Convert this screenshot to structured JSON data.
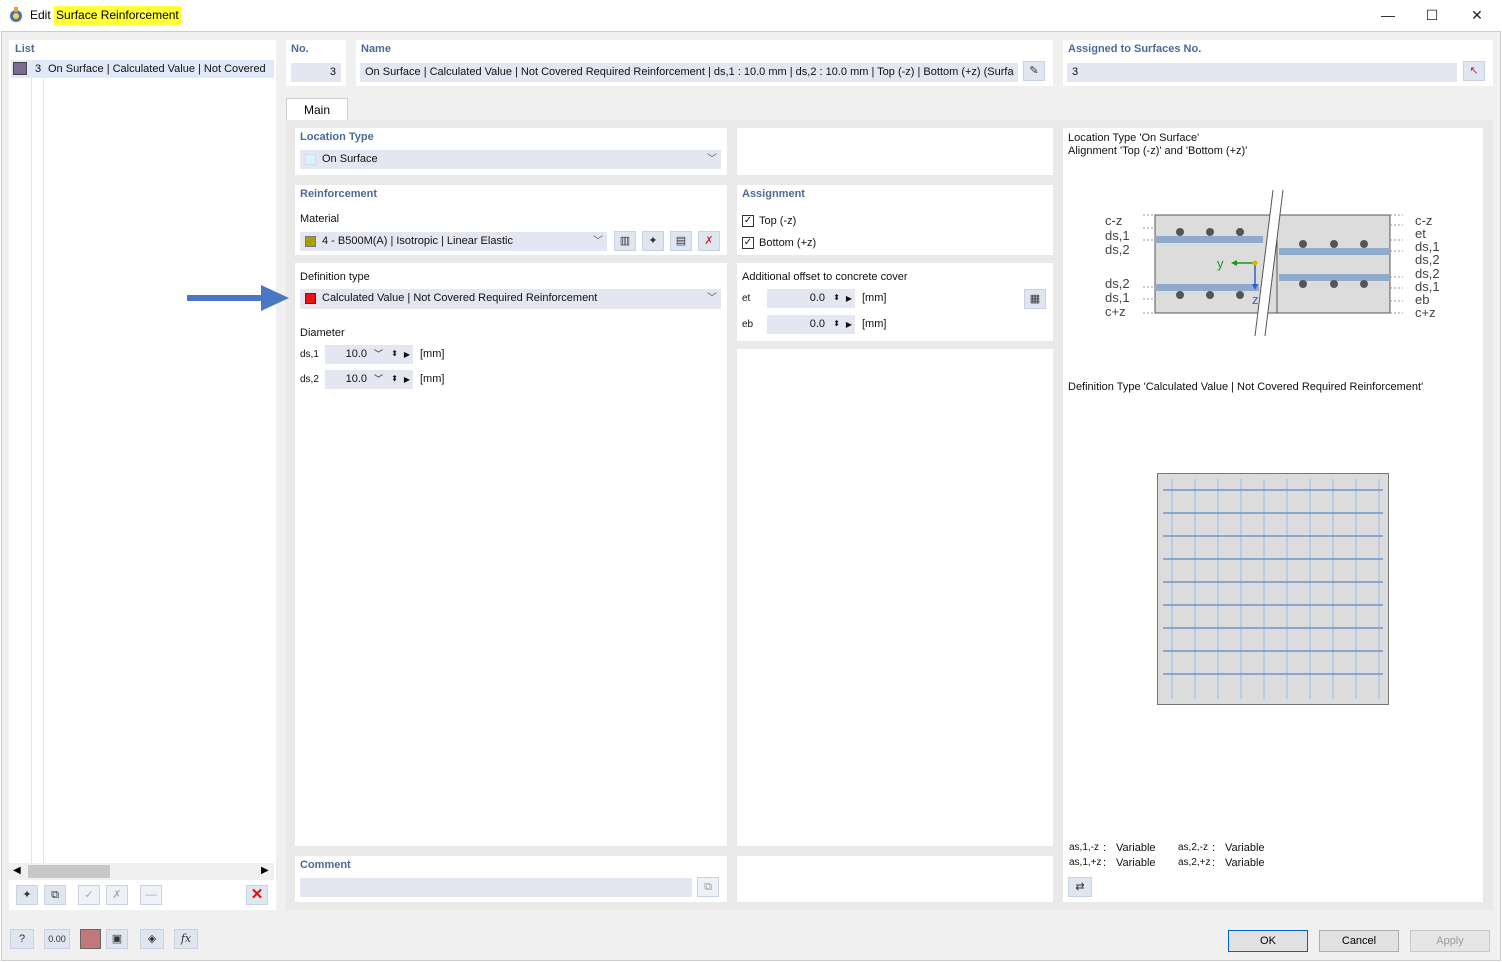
{
  "window": {
    "title_prefix": "Edit",
    "title_highlight": "Surface Reinforcement",
    "minimize": "—",
    "maximize": "☐",
    "close": "✕"
  },
  "list": {
    "header": "List",
    "items": [
      {
        "no": "3",
        "label": "On Surface | Calculated Value | Not Covered"
      }
    ]
  },
  "no": {
    "header": "No.",
    "value": "3"
  },
  "name": {
    "header": "Name",
    "value": "On Surface | Calculated Value | Not Covered Required Reinforcement | ds,1 : 10.0 mm | ds,2 : 10.0 mm | Top (-z) | Bottom (+z) (Surfa"
  },
  "assigned": {
    "header": "Assigned to Surfaces No.",
    "value": "3"
  },
  "tabs": [
    {
      "label": "Main"
    }
  ],
  "location_type": {
    "header": "Location Type",
    "value": "On Surface",
    "color": "#d8f4ff"
  },
  "reinforcement": {
    "header": "Reinforcement",
    "material_label": "Material",
    "material_value": "4 - B500M(A) | Isotropic | Linear Elastic",
    "material_color": "#a8a000"
  },
  "definition": {
    "label": "Definition type",
    "value": "Calculated Value | Not Covered Required Reinforcement",
    "color": "#ee1111"
  },
  "diameter": {
    "label": "Diameter",
    "rows": [
      {
        "sym": "ds,1",
        "value": "10.0",
        "unit": "[mm]"
      },
      {
        "sym": "ds,2",
        "value": "10.0",
        "unit": "[mm]"
      }
    ]
  },
  "assignment": {
    "header": "Assignment",
    "top": "Top (-z)",
    "bottom": "Bottom (+z)"
  },
  "offset": {
    "label": "Additional offset to concrete cover",
    "rows": [
      {
        "sym": "et",
        "value": "0.0",
        "unit": "[mm]"
      },
      {
        "sym": "eb",
        "value": "0.0",
        "unit": "[mm]"
      }
    ]
  },
  "comment": {
    "header": "Comment",
    "value": ""
  },
  "info": {
    "loc_line1": "Location Type 'On Surface'",
    "loc_line2": "Alignment 'Top (-z)' and 'Bottom (+z)'",
    "def_line": "Definition Type 'Calculated Value | Not Covered Required Reinforcement'",
    "diagram_left": [
      "c-z",
      "ds,1",
      "ds,2",
      "ds,2",
      "ds,1",
      "c+z"
    ],
    "diagram_right": [
      "c-z",
      "et",
      "ds,1",
      "ds,2",
      "ds,2",
      "ds,1",
      "eb",
      "c+z"
    ],
    "axis_y": "y",
    "axis_z": "z",
    "as_rows": [
      {
        "k1": "as,1,-z",
        "v1": "Variable",
        "k2": "as,2,-z",
        "v2": "Variable"
      },
      {
        "k1": "as,1,+z",
        "v1": "Variable",
        "k2": "as,2,+z",
        "v2": "Variable"
      }
    ]
  },
  "buttons": {
    "ok": "OK",
    "cancel": "Cancel",
    "apply": "Apply"
  },
  "bottom_icons": {
    "decimal": "0.00",
    "fx": "fx"
  }
}
